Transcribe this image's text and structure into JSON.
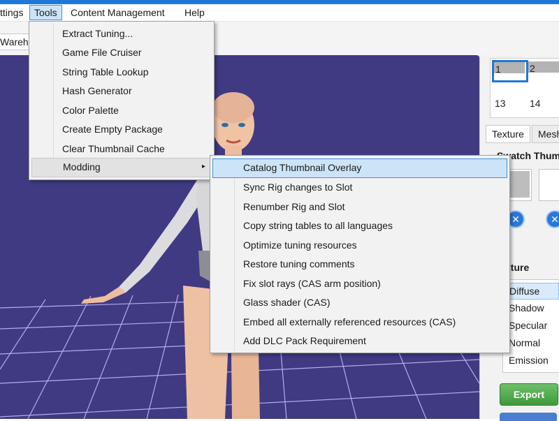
{
  "menubar": {
    "items": [
      "ttings",
      "Tools",
      "Content Management",
      "Help"
    ]
  },
  "toolbar": {
    "tab_stub": "Wareh"
  },
  "tools_menu": {
    "items": [
      "Extract Tuning...",
      "Game File Cruiser",
      "String Table Lookup",
      "Hash Generator",
      "Color Palette",
      "Create Empty Package",
      "Clear Thumbnail Cache",
      "Modding"
    ],
    "submenu_arrow": "▸"
  },
  "modding_menu": {
    "items": [
      "Catalog Thumbnail Overlay",
      "Sync Rig changes to Slot",
      "Renumber Rig and Slot",
      "Copy string tables to all languages",
      "Optimize tuning resources",
      "Restore tuning comments",
      "Fix slot rays (CAS arm position)",
      "Glass shader (CAS)",
      "Embed all externally referenced resources (CAS)",
      "Add DLC Pack Requirement"
    ]
  },
  "right_panel": {
    "thumbs": [
      "1",
      "2",
      "13",
      "14"
    ],
    "tabs": [
      "Texture",
      "Mesh"
    ],
    "swatch_title": "Swatch Thum",
    "remove_icon": "✕",
    "texture_label": "xture",
    "texture_list": [
      "Diffuse",
      "Shadow",
      "Specular",
      "Normal",
      "Emission"
    ],
    "export_label": "Export"
  },
  "colors": {
    "accent": "#1e78d8",
    "viewport": "#3f3a82",
    "grid": "#c9c3ff",
    "highlight": "#cce4f7",
    "export": "#4ea84a"
  }
}
